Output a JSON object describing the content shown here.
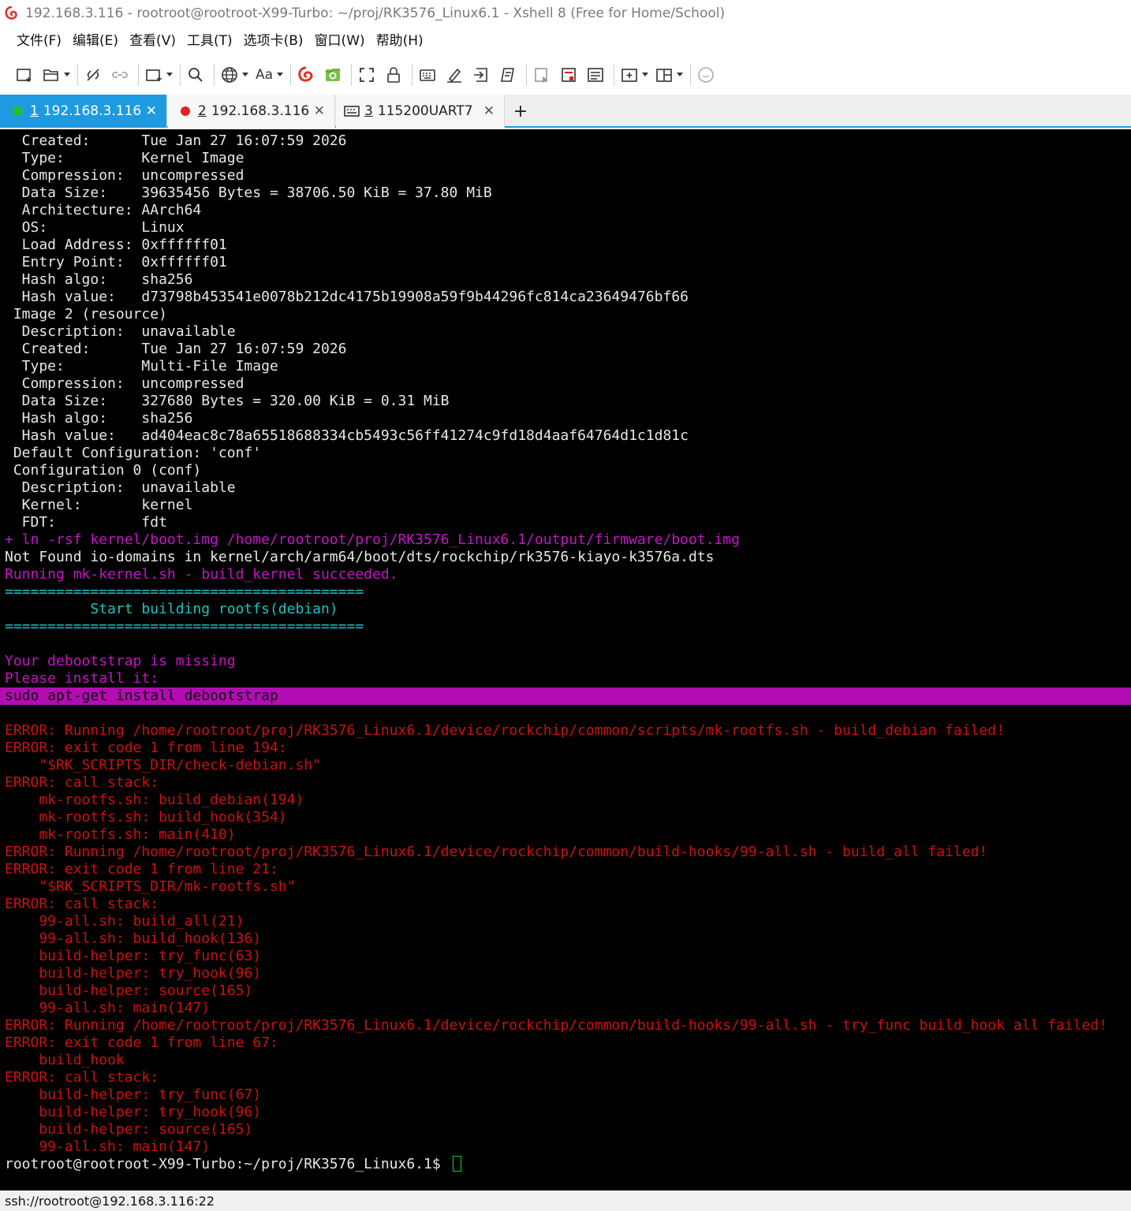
{
  "window": {
    "title": "192.168.3.116 - rootroot@rootroot-X99-Turbo: ~/proj/RK3576_Linux6.1 - Xshell 8 (Free for Home/School)",
    "app_icon": "xshell-logo-icon"
  },
  "menu": {
    "items": [
      {
        "label": "文件(F)"
      },
      {
        "label": "编辑(E)"
      },
      {
        "label": "查看(V)"
      },
      {
        "label": "工具(T)"
      },
      {
        "label": "选项卡(B)"
      },
      {
        "label": "窗口(W)"
      },
      {
        "label": "帮助(H)"
      }
    ]
  },
  "toolbar": {
    "font_label": "Aa",
    "icons": [
      "new-session-icon",
      "open-folder-icon",
      "disconnect-icon",
      "reconnect-icon",
      "new-tab-icon",
      "search-icon",
      "globe-icon",
      "font-icon",
      "xshell-icon",
      "xftp-icon",
      "fullscreen-icon",
      "lock-icon",
      "keyboard-icon",
      "highlight-icon",
      "transfer-icon",
      "script-icon",
      "compose-icon",
      "compose-bar-icon",
      "session-manager-icon",
      "add-tab-icon",
      "layout-icon",
      "chat-icon"
    ]
  },
  "tabs": [
    {
      "number": "1",
      "label": "192.168.3.116",
      "status_color": "#22c322",
      "active": true
    },
    {
      "number": "2",
      "label": "192.168.3.116",
      "status_color": "#e02424",
      "active": false
    },
    {
      "number": "3",
      "label": "115200UART7",
      "status_color": "",
      "active": false
    }
  ],
  "tab_close": "✕",
  "tab_add": "+",
  "terminal": {
    "lines": [
      {
        "text": "  Created:      Tue Jan 27 16:07:59 2026",
        "color": "w"
      },
      {
        "text": "  Type:         Kernel Image",
        "color": "w"
      },
      {
        "text": "  Compression:  uncompressed",
        "color": "w"
      },
      {
        "text": "  Data Size:    39635456 Bytes = 38706.50 KiB = 37.80 MiB",
        "color": "w"
      },
      {
        "text": "  Architecture: AArch64",
        "color": "w"
      },
      {
        "text": "  OS:           Linux",
        "color": "w"
      },
      {
        "text": "  Load Address: 0xffffff01",
        "color": "w"
      },
      {
        "text": "  Entry Point:  0xffffff01",
        "color": "w"
      },
      {
        "text": "  Hash algo:    sha256",
        "color": "w"
      },
      {
        "text": "  Hash value:   d73798b453541e0078b212dc4175b19908a59f9b44296fc814ca23649476bf66",
        "color": "w"
      },
      {
        "text": " Image 2 (resource)",
        "color": "w"
      },
      {
        "text": "  Description:  unavailable",
        "color": "w"
      },
      {
        "text": "  Created:      Tue Jan 27 16:07:59 2026",
        "color": "w"
      },
      {
        "text": "  Type:         Multi-File Image",
        "color": "w"
      },
      {
        "text": "  Compression:  uncompressed",
        "color": "w"
      },
      {
        "text": "  Data Size:    327680 Bytes = 320.00 KiB = 0.31 MiB",
        "color": "w"
      },
      {
        "text": "  Hash algo:    sha256",
        "color": "w"
      },
      {
        "text": "  Hash value:   ad404eac8c78a65518688334cb5493c56ff41274c9fd18d4aaf64764d1c1d81c",
        "color": "w"
      },
      {
        "text": " Default Configuration: 'conf'",
        "color": "w"
      },
      {
        "text": " Configuration 0 (conf)",
        "color": "w"
      },
      {
        "text": "  Description:  unavailable",
        "color": "w"
      },
      {
        "text": "  Kernel:       kernel",
        "color": "w"
      },
      {
        "text": "  FDT:          fdt",
        "color": "w"
      },
      {
        "text": "+ ln -rsf kernel/boot.img /home/rootroot/proj/RK3576_Linux6.1/output/firmware/boot.img",
        "color": "m"
      },
      {
        "text": "Not Found io-domains in kernel/arch/arm64/boot/dts/rockchip/rk3576-kiayo-k3576a.dts",
        "color": "w"
      },
      {
        "text": "Running mk-kernel.sh - build_kernel succeeded.",
        "color": "m"
      },
      {
        "text": "==========================================",
        "color": "c"
      },
      {
        "text": "          Start building rootfs(debian)",
        "color": "c"
      },
      {
        "text": "==========================================",
        "color": "c"
      },
      {
        "text": "",
        "color": "w"
      },
      {
        "text": "Your debootstrap is missing",
        "color": "m"
      },
      {
        "text": "Please install it:",
        "color": "m"
      },
      {
        "text": "sudo apt-get install debootstrap",
        "color": "hl"
      },
      {
        "text": "",
        "color": "w"
      },
      {
        "text": "ERROR: Running /home/rootroot/proj/RK3576_Linux6.1/device/rockchip/common/scripts/mk-rootfs.sh - build_debian failed!",
        "color": "r"
      },
      {
        "text": "ERROR: exit code 1 from line 194:",
        "color": "r"
      },
      {
        "text": "    \"$RK_SCRIPTS_DIR/check-debian.sh\"",
        "color": "r"
      },
      {
        "text": "ERROR: call stack:",
        "color": "r"
      },
      {
        "text": "    mk-rootfs.sh: build_debian(194)",
        "color": "r"
      },
      {
        "text": "    mk-rootfs.sh: build_hook(354)",
        "color": "r"
      },
      {
        "text": "    mk-rootfs.sh: main(410)",
        "color": "r"
      },
      {
        "text": "ERROR: Running /home/rootroot/proj/RK3576_Linux6.1/device/rockchip/common/build-hooks/99-all.sh - build_all failed!",
        "color": "r"
      },
      {
        "text": "ERROR: exit code 1 from line 21:",
        "color": "r"
      },
      {
        "text": "    \"$RK_SCRIPTS_DIR/mk-rootfs.sh\"",
        "color": "r"
      },
      {
        "text": "ERROR: call stack:",
        "color": "r"
      },
      {
        "text": "    99-all.sh: build_all(21)",
        "color": "r"
      },
      {
        "text": "    99-all.sh: build_hook(136)",
        "color": "r"
      },
      {
        "text": "    build-helper: try_func(63)",
        "color": "r"
      },
      {
        "text": "    build-helper: try_hook(96)",
        "color": "r"
      },
      {
        "text": "    build-helper: source(165)",
        "color": "r"
      },
      {
        "text": "    99-all.sh: main(147)",
        "color": "r"
      },
      {
        "text": "ERROR: Running /home/rootroot/proj/RK3576_Linux6.1/device/rockchip/common/build-hooks/99-all.sh - try_func build_hook all failed!",
        "color": "r"
      },
      {
        "text": "ERROR: exit code 1 from line 67:",
        "color": "r"
      },
      {
        "text": "    build_hook",
        "color": "r"
      },
      {
        "text": "ERROR: call stack:",
        "color": "r"
      },
      {
        "text": "    build-helper: try_func(67)",
        "color": "r"
      },
      {
        "text": "    build-helper: try_hook(96)",
        "color": "r"
      },
      {
        "text": "    build-helper: source(165)",
        "color": "r"
      },
      {
        "text": "    99-all.sh: main(147)",
        "color": "r"
      }
    ],
    "prompt": "rootroot@rootroot-X99-Turbo:~/proj/RK3576_Linux6.1$ "
  },
  "status": {
    "connection": "ssh://rootroot@192.168.3.116:22"
  }
}
